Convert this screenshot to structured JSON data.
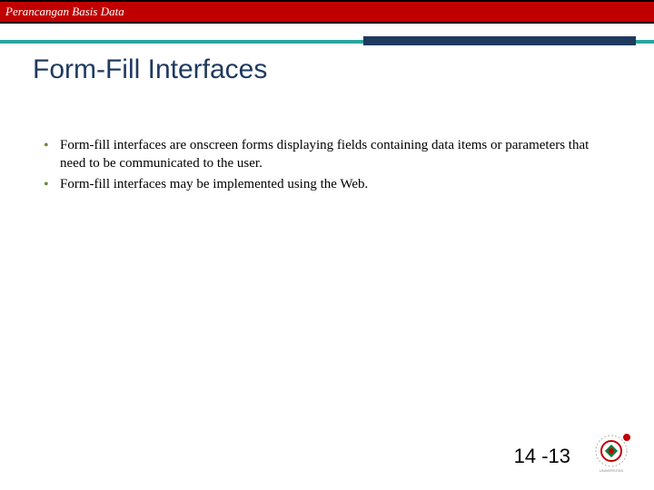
{
  "header": {
    "course": "Perancangan Basis Data"
  },
  "slide": {
    "title": "Form-Fill Interfaces",
    "bullets": [
      "Form-fill interfaces are onscreen forms displaying fields containing data items or parameters that need to be communicated to the user.",
      "Form-fill interfaces may be implemented using the Web."
    ],
    "page": "14 -13"
  }
}
